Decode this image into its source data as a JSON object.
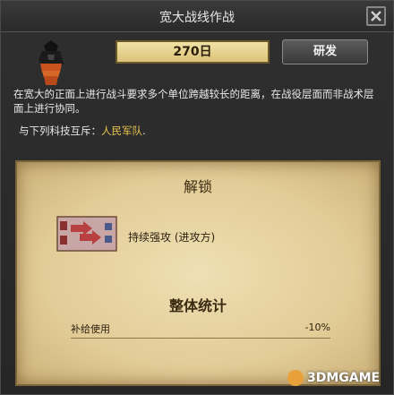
{
  "window": {
    "title": "宽大战线作战"
  },
  "research": {
    "days": "270日",
    "button_label": "研发"
  },
  "description": "在宽大的正面上进行战斗要求多个单位跨越较长的距离，在战役层面而非战术层面上进行协同。",
  "exclusive": {
    "label": "与下列科技互斥：",
    "tech": "人民军队",
    "suffix": "."
  },
  "unlock": {
    "title": "解锁",
    "item_label": "持续强攻 (进攻方)"
  },
  "stats": {
    "title": "整体统计",
    "rows": [
      {
        "name": "补给使用",
        "value": "-10%"
      }
    ]
  },
  "watermark": {
    "text": "3DMGAME"
  },
  "colors": {
    "accent_gold": "#e6c34a",
    "parchment": "#e2cc97"
  }
}
